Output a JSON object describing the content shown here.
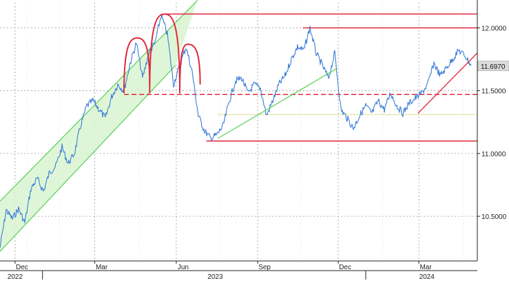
{
  "chart_data": {
    "type": "line",
    "grid": true,
    "legend": "none",
    "x_axis": {
      "range": [
        "2022-11-14",
        "2024-05-06"
      ],
      "month_ticks": [
        {
          "label": "Dec",
          "date": "2022-12-01"
        },
        {
          "label": "Mar",
          "date": "2023-03-01"
        },
        {
          "label": "Jun",
          "date": "2023-06-01"
        },
        {
          "label": "Sep",
          "date": "2023-09-01"
        },
        {
          "label": "Dec",
          "date": "2023-12-01"
        },
        {
          "label": "Mar",
          "date": "2024-03-01"
        }
      ],
      "year_labels": [
        {
          "label": "2022",
          "date": "2022-12-01"
        },
        {
          "label": "2023",
          "date": "2023-07-15"
        },
        {
          "label": "2024",
          "date": "2024-03-10"
        }
      ]
    },
    "y_axis": {
      "side": "right",
      "range": [
        10.15,
        12.2
      ],
      "ticks": [
        {
          "value": 12.0,
          "label": "12.0000"
        },
        {
          "value": 11.5,
          "label": "11.5000"
        },
        {
          "value": 11.0,
          "label": "11.0000"
        },
        {
          "value": 10.5,
          "label": "10.5000"
        }
      ]
    },
    "last_value": {
      "value": 11.697,
      "label": "11.6970"
    },
    "series": [
      {
        "color": "#3a7dd6",
        "points": [
          [
            "2022-11-14",
            10.25
          ],
          [
            "2022-11-21",
            10.55
          ],
          [
            "2022-11-28",
            10.48
          ],
          [
            "2022-12-05",
            10.56
          ],
          [
            "2022-12-12",
            10.45
          ],
          [
            "2022-12-19",
            10.72
          ],
          [
            "2022-12-26",
            10.8
          ],
          [
            "2023-01-02",
            10.7
          ],
          [
            "2023-01-09",
            10.85
          ],
          [
            "2023-01-16",
            10.9
          ],
          [
            "2023-01-23",
            11.05
          ],
          [
            "2023-01-30",
            10.92
          ],
          [
            "2023-02-06",
            11.0
          ],
          [
            "2023-02-13",
            11.22
          ],
          [
            "2023-02-20",
            11.38
          ],
          [
            "2023-02-27",
            11.42
          ],
          [
            "2023-03-06",
            11.35
          ],
          [
            "2023-03-13",
            11.28
          ],
          [
            "2023-03-20",
            11.45
          ],
          [
            "2023-03-27",
            11.55
          ],
          [
            "2023-04-03",
            11.5
          ],
          [
            "2023-04-10",
            11.72
          ],
          [
            "2023-04-17",
            11.88
          ],
          [
            "2023-04-24",
            11.6
          ],
          [
            "2023-05-01",
            11.8
          ],
          [
            "2023-05-08",
            11.88
          ],
          [
            "2023-05-15",
            12.1
          ],
          [
            "2023-05-22",
            11.95
          ],
          [
            "2023-05-29",
            11.55
          ],
          [
            "2023-06-05",
            11.7
          ],
          [
            "2023-06-12",
            11.85
          ],
          [
            "2023-06-19",
            11.65
          ],
          [
            "2023-06-26",
            11.3
          ],
          [
            "2023-07-03",
            11.18
          ],
          [
            "2023-07-10",
            11.12
          ],
          [
            "2023-07-17",
            11.15
          ],
          [
            "2023-07-24",
            11.22
          ],
          [
            "2023-07-31",
            11.42
          ],
          [
            "2023-08-07",
            11.58
          ],
          [
            "2023-08-14",
            11.6
          ],
          [
            "2023-08-21",
            11.48
          ],
          [
            "2023-08-28",
            11.55
          ],
          [
            "2023-09-04",
            11.52
          ],
          [
            "2023-09-11",
            11.3
          ],
          [
            "2023-09-18",
            11.42
          ],
          [
            "2023-09-25",
            11.55
          ],
          [
            "2023-10-02",
            11.62
          ],
          [
            "2023-10-09",
            11.75
          ],
          [
            "2023-10-16",
            11.85
          ],
          [
            "2023-10-23",
            11.82
          ],
          [
            "2023-10-30",
            12.0
          ],
          [
            "2023-11-06",
            11.8
          ],
          [
            "2023-11-13",
            11.7
          ],
          [
            "2023-11-20",
            11.6
          ],
          [
            "2023-11-27",
            11.8
          ],
          [
            "2023-12-04",
            11.35
          ],
          [
            "2023-12-11",
            11.28
          ],
          [
            "2023-12-18",
            11.2
          ],
          [
            "2023-12-25",
            11.3
          ],
          [
            "2024-01-01",
            11.38
          ],
          [
            "2024-01-08",
            11.32
          ],
          [
            "2024-01-15",
            11.42
          ],
          [
            "2024-01-22",
            11.35
          ],
          [
            "2024-01-29",
            11.48
          ],
          [
            "2024-02-05",
            11.38
          ],
          [
            "2024-02-12",
            11.32
          ],
          [
            "2024-02-19",
            11.4
          ],
          [
            "2024-02-26",
            11.44
          ],
          [
            "2024-03-04",
            11.48
          ],
          [
            "2024-03-11",
            11.55
          ],
          [
            "2024-03-18",
            11.72
          ],
          [
            "2024-03-25",
            11.62
          ],
          [
            "2024-04-01",
            11.68
          ],
          [
            "2024-04-08",
            11.75
          ],
          [
            "2024-04-15",
            11.82
          ],
          [
            "2024-04-22",
            11.78
          ],
          [
            "2024-04-29",
            11.7
          ]
        ]
      }
    ],
    "overlays": {
      "channel": {
        "color": "#5fd35f",
        "fill": "#d8f5d0",
        "lower": [
          [
            "2022-11-14",
            10.22
          ],
          [
            "2023-05-31",
            11.7
          ]
        ],
        "upper": [
          [
            "2022-11-14",
            10.62
          ],
          [
            "2023-06-25",
            12.22
          ]
        ]
      },
      "arcs": {
        "color": "#e0283a",
        "items": [
          {
            "from": [
              "2023-04-03",
              11.48
            ],
            "peak": [
              "2023-04-18",
              11.92
            ],
            "to": [
              "2023-05-02",
              11.55
            ]
          },
          {
            "from": [
              "2023-05-02",
              11.48
            ],
            "peak": [
              "2023-05-19",
              12.11
            ],
            "to": [
              "2023-06-05",
              11.48
            ]
          },
          {
            "from": [
              "2023-06-05",
              11.48
            ],
            "peak": [
              "2023-06-14",
              11.87
            ],
            "to": [
              "2023-06-28",
              11.55
            ]
          }
        ]
      },
      "hlines": [
        {
          "y": 12.11,
          "from": "2023-05-19",
          "to": "2024-05-06",
          "color": "#e0283a",
          "dashed": false
        },
        {
          "y": 12.0,
          "from": "2023-10-22",
          "to": "2024-05-06",
          "color": "#e0283a",
          "dashed": false
        },
        {
          "y": 11.47,
          "from": "2023-04-03",
          "to": "2024-05-06",
          "color": "#e0283a",
          "dashed": true
        },
        {
          "y": 11.31,
          "from": "2023-07-18",
          "to": "2024-05-06",
          "color": "#e9e9b5",
          "dashed": false
        },
        {
          "y": 11.1,
          "from": "2023-07-05",
          "to": "2024-05-06",
          "color": "#e0283a",
          "dashed": false
        }
      ],
      "trendlines": [
        {
          "from": [
            "2023-07-18",
            11.12
          ],
          "to": [
            "2023-11-30",
            11.68
          ],
          "color": "#5fd35f"
        },
        {
          "from": [
            "2024-02-29",
            11.32
          ],
          "to": [
            "2024-05-06",
            11.8
          ],
          "color": "#e0283a"
        }
      ]
    }
  }
}
